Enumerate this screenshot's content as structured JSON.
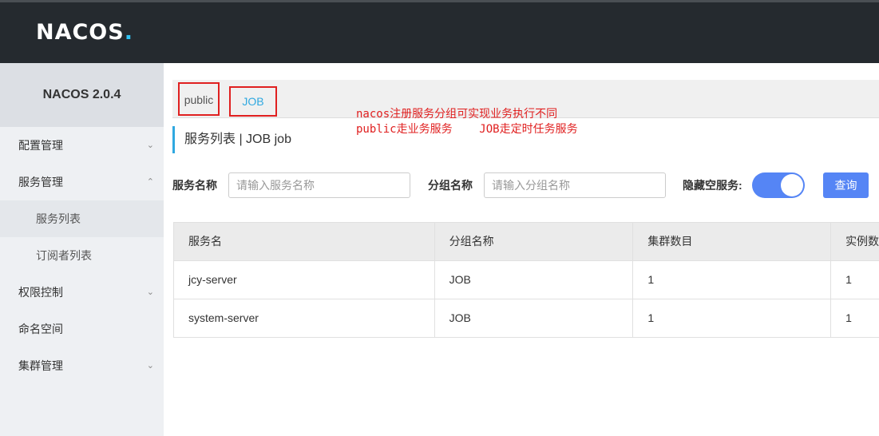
{
  "header": {
    "logo_text": "NACOS",
    "logo_dot": "."
  },
  "sidebar": {
    "version": "NACOS 2.0.4",
    "items": [
      {
        "label": "配置管理",
        "chevron": "chevron-down"
      },
      {
        "label": "服务管理",
        "chevron": "chevron-up"
      },
      {
        "label": "服务列表",
        "sub": true,
        "active": true
      },
      {
        "label": "订阅者列表",
        "sub": true
      },
      {
        "label": "权限控制",
        "chevron": "chevron-down"
      },
      {
        "label": "命名空间"
      },
      {
        "label": "集群管理",
        "chevron": "chevron-down"
      }
    ]
  },
  "namespaces": {
    "public": "public",
    "job": "JOB"
  },
  "annotation": {
    "line1": "nacos注册服务分组可实现业务执行不同",
    "line2": "public走业务服务    JOB走定时任务服务"
  },
  "page": {
    "title": "服务列表 | JOB job"
  },
  "filters": {
    "service_name_label": "服务名称",
    "service_name_placeholder": "请输入服务名称",
    "group_name_label": "分组名称",
    "group_name_placeholder": "请输入分组名称",
    "hide_empty_label": "隐藏空服务:",
    "hide_empty_on": true,
    "query_label": "查询"
  },
  "table": {
    "headers": [
      "服务名",
      "分组名称",
      "集群数目",
      "实例数"
    ],
    "rows": [
      [
        "jcy-server",
        "JOB",
        "1",
        "1"
      ],
      [
        "system-server",
        "JOB",
        "1",
        "1"
      ]
    ]
  },
  "colors": {
    "accent": "#5585f5",
    "link": "#2fa8e0",
    "annotation": "#e02020",
    "topbar": "#252a2f"
  }
}
